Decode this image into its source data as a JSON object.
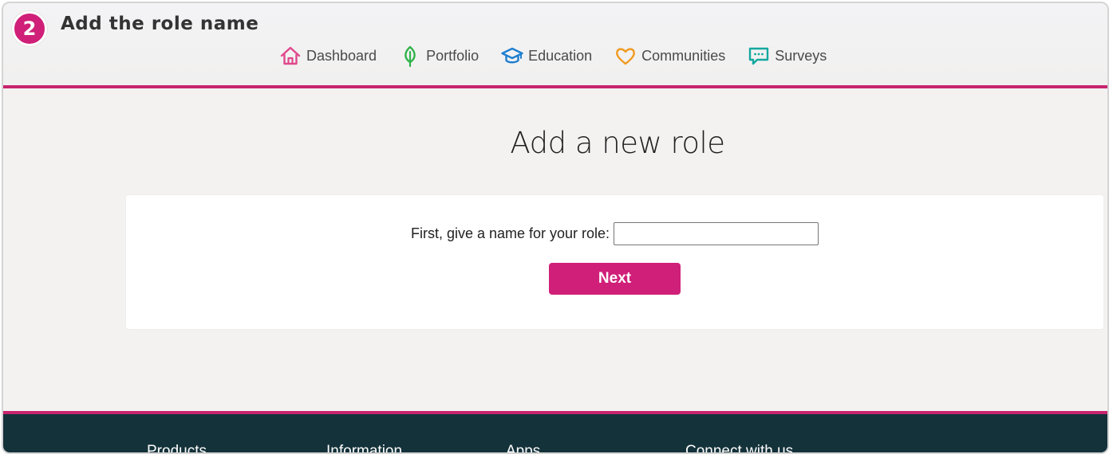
{
  "step": {
    "number": "2",
    "title": "Add the role name"
  },
  "nav": {
    "items": [
      {
        "label": "Dashboard",
        "icon": "home-icon",
        "color": "#e0488c"
      },
      {
        "label": "Portfolio",
        "icon": "leaf-icon",
        "color": "#2fb34a"
      },
      {
        "label": "Education",
        "icon": "graduation-cap-icon",
        "color": "#1f7fd1"
      },
      {
        "label": "Communities",
        "icon": "heart-icon",
        "color": "#f09a1f"
      },
      {
        "label": "Surveys",
        "icon": "speech-bubble-icon",
        "color": "#14a8a0"
      }
    ]
  },
  "main": {
    "title": "Add a new role",
    "form": {
      "label": "First, give a name for your role:",
      "input_value": "",
      "next_label": "Next"
    }
  },
  "footer": {
    "columns": [
      "Products",
      "Information",
      "Apps",
      "Connect with us"
    ]
  },
  "colors": {
    "accent": "#d01f78",
    "rule": "#c8246f",
    "footer_bg": "#14323a",
    "page_bg": "#f4f2f1"
  }
}
